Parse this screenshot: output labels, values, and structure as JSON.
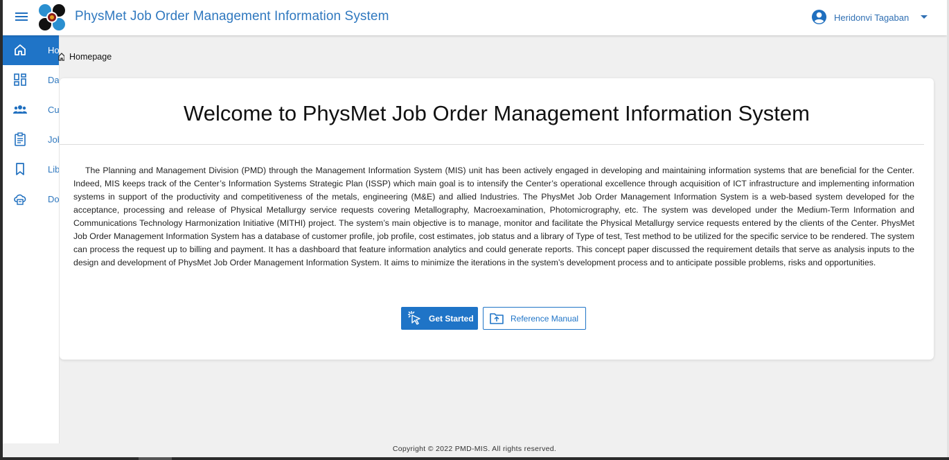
{
  "header": {
    "title": "PhysMet Job Order Management Information System",
    "user_name": "Heridonvi Tagaban"
  },
  "sidebar": {
    "items": [
      {
        "label": "Homepage",
        "icon": "home-icon",
        "active": true
      },
      {
        "label": "Dashboard",
        "icon": "dashboard-icon",
        "active": false
      },
      {
        "label": "Customers",
        "icon": "customers-icon",
        "active": false
      },
      {
        "label": "Job Orders",
        "icon": "clipboard-icon",
        "active": false
      },
      {
        "label": "Library",
        "icon": "bookmark-icon",
        "active": false
      },
      {
        "label": "Download",
        "icon": "cloud-download-icon",
        "active": false
      }
    ]
  },
  "breadcrumb": {
    "icon": "home-icon",
    "label": "Homepage"
  },
  "main": {
    "title": "Welcome to PhysMet Job Order Management Information System",
    "body": "The Planning and Management Division (PMD) through the Management Information System (MIS) unit has been actively engaged in developing and maintaining information systems that are beneficial for the Center. Indeed, MIS keeps track of the Center’s Information Systems Strategic Plan (ISSP) which main goal is to intensify the Center’s operational excellence through acquisition of ICT infrastructure and implementing information systems in support of the productivity and competitiveness of the metals, engineering (M&E) and allied Industries. The PhysMet Job Order Management Information System is a web-based system developed for the acceptance, processing and release of Physical Metallurgy service requests covering Metallography, Macroexamination, Photomicrography, etc. The system was developed under the Medium-Term Information and Communications Technology Harmonization Initiative (MITHI) project. The system’s main objective is to manage, monitor and facilitate the Physical Metallurgy service requests entered by the clients of the Center. PhysMet Job Order Management Information System has a database of customer profile, job profile, cost estimates, job status and a library of Type of test, Test method to be utilized for the specific service to be rendered. The system can process the request up to billing and payment. It has a dashboard that feature information analytics and could generate reports. This concept paper discussed the requirement details that serve as analysis inputs to the design and development of PhysMet Job Order Management Information System. It aims to minimize the iterations in the system’s development process and to anticipate possible problems, risks and opportunities.",
    "get_started_label": "Get Started",
    "reference_manual_label": "Reference Manual"
  },
  "footer": {
    "copyright": "Copyright © 2022 PMD-MIS. All rights reserved."
  },
  "colors": {
    "primary": "#1f74c7",
    "title_blue": "#2f78bf",
    "background": "#f0f0f0"
  }
}
